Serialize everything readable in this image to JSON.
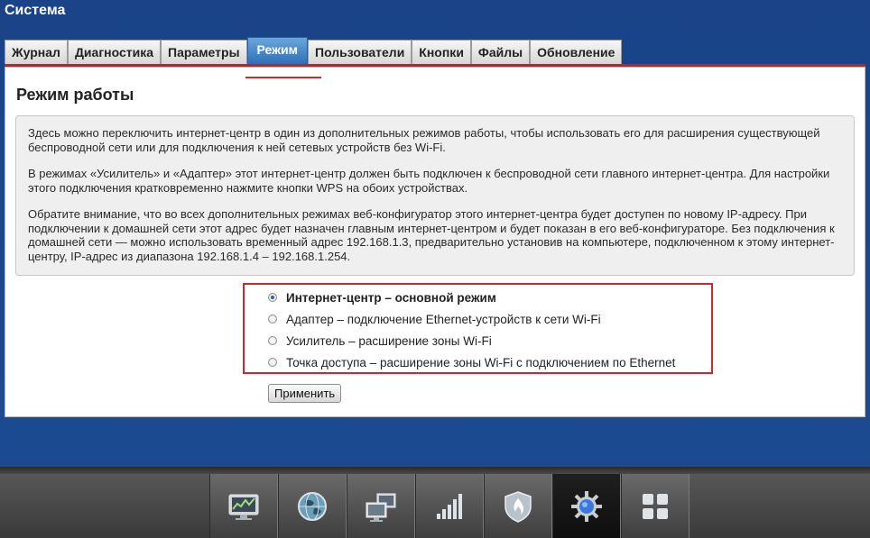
{
  "header": {
    "title": "Система"
  },
  "tabs": [
    {
      "label": "Журнал",
      "active": false
    },
    {
      "label": "Диагностика",
      "active": false
    },
    {
      "label": "Параметры",
      "active": false
    },
    {
      "label": "Режим",
      "active": true
    },
    {
      "label": "Пользователи",
      "active": false
    },
    {
      "label": "Кнопки",
      "active": false
    },
    {
      "label": "Файлы",
      "active": false
    },
    {
      "label": "Обновление",
      "active": false
    }
  ],
  "panel": {
    "title": "Режим работы",
    "paragraphs": [
      "Здесь можно переключить интернет-центр в один из дополнительных режимов работы, чтобы использовать его для расширения существующей беспроводной сети или для подключения к ней сетевых устройств без Wi-Fi.",
      "В режимах «Усилитель» и «Адаптер» этот интернет-центр должен быть подключен к беспроводной сети главного интернет-центра. Для настройки этого подключения кратковременно нажмите кнопки WPS на обоих устройствах.",
      "Обратите внимание, что во всех дополнительных режимах веб-конфигуратор этого интернет-центра будет доступен по новому IP-адресу. При подключении к домашней сети этот адрес будет назначен главным интернет-центром и будет показан в его веб-конфигураторе. Без подключения к домашней сети — можно использовать временный адрес 192.168.1.3, предварительно установив на компьютере, подключенном к этому интернет-центру, IP-адрес из диапазона 192.168.1.4 – 192.168.1.254."
    ],
    "modes": [
      {
        "label": "Интернет-центр – основной режим",
        "selected": true
      },
      {
        "label": "Адаптер – подключение Ethernet-устройств к сети Wi-Fi",
        "selected": false
      },
      {
        "label": "Усилитель – расширение зоны Wi-Fi",
        "selected": false
      },
      {
        "label": "Точка доступа – расширение зоны Wi-Fi с подключением по Ethernet",
        "selected": false
      }
    ],
    "apply_label": "Применить"
  },
  "dock": {
    "items": [
      {
        "icon": "monitor-chart-icon"
      },
      {
        "icon": "globe-icon"
      },
      {
        "icon": "network-computers-icon"
      },
      {
        "icon": "signal-bars-icon"
      },
      {
        "icon": "shield-icon"
      },
      {
        "icon": "gear-icon",
        "active": true
      },
      {
        "icon": "apps-grid-icon"
      }
    ]
  },
  "colors": {
    "accent": "#2f6fb6",
    "highlight": "#d0262f",
    "background": "#1b4488"
  }
}
